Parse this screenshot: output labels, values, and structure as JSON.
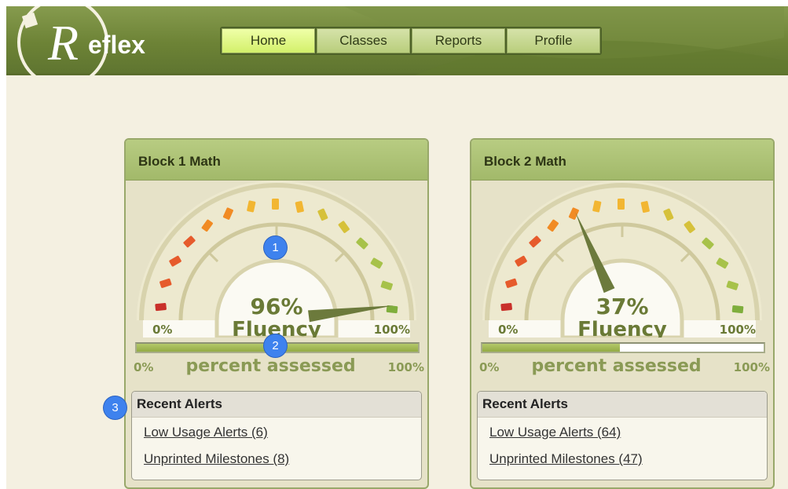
{
  "app": {
    "logo_text": "Reflex"
  },
  "nav": {
    "tabs": [
      {
        "label": "Home",
        "active": true
      },
      {
        "label": "Classes",
        "active": false
      },
      {
        "label": "Reports",
        "active": false
      },
      {
        "label": "Profile",
        "active": false
      }
    ]
  },
  "classes": [
    {
      "title": "Block 1 Math",
      "fluency_pct": "96%",
      "fluency_label": "Fluency",
      "fluency_value": 0.96,
      "scale_min": "0%",
      "scale_max": "100%",
      "assessed_fraction": 1.0,
      "assessed_label": "percent assessed",
      "assessed_min": "0%",
      "assessed_max": "100%",
      "alerts_title": "Recent Alerts",
      "alerts": [
        "Low Usage Alerts (6)",
        "Unprinted Milestones (8)"
      ]
    },
    {
      "title": "Block 2 Math",
      "fluency_pct": "37%",
      "fluency_label": "Fluency",
      "fluency_value": 0.37,
      "scale_min": "0%",
      "scale_max": "100%",
      "assessed_fraction": 0.49,
      "assessed_label": "percent assessed",
      "assessed_min": "0%",
      "assessed_max": "100%",
      "alerts_title": "Recent Alerts",
      "alerts": [
        "Low Usage Alerts (64)",
        "Unprinted Milestones (47)"
      ]
    }
  ],
  "annotations": [
    "1",
    "2",
    "3"
  ],
  "colors": {
    "header": "#6d8336",
    "page_bg": "#f4f0e1",
    "card_head": "#a8bd72",
    "gauge_label": "#8a9a55",
    "progress_fill": "#9ab04c",
    "badge": "#3e82ee",
    "segment_gradient": [
      "#c9302a",
      "#e65b2c",
      "#f18b24",
      "#f2b632",
      "#d6c13a",
      "#a7c24a",
      "#7fae3c"
    ]
  }
}
